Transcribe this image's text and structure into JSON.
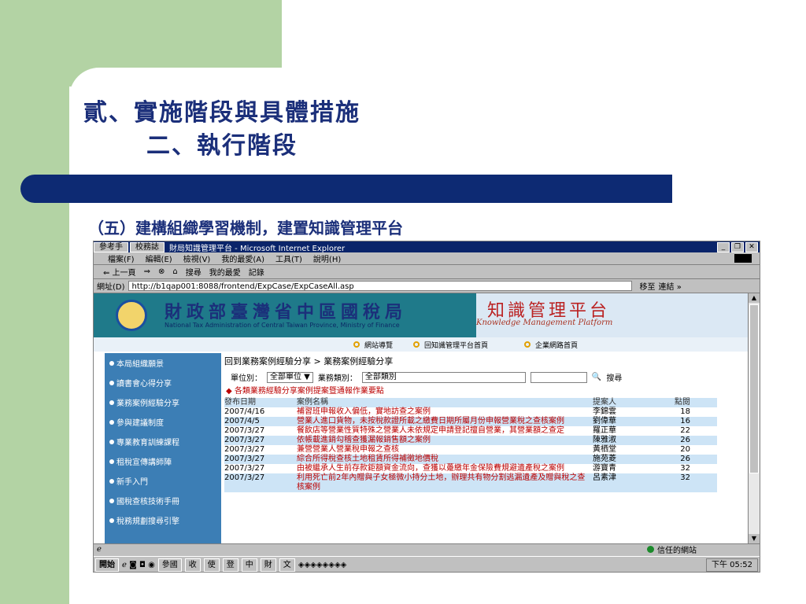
{
  "slide": {
    "title_line1": "貳、實施階段與具體措施",
    "title_line2": "二、執行階段",
    "subtitle": "（五）建構組織學習機制，建置知識管理平台"
  },
  "browser": {
    "title_tabs": [
      "參考手",
      "校務誌"
    ],
    "window_title": "財局知識管理平台 - Microsoft Internet Explorer",
    "menu": [
      "檔案(F)",
      "編輯(E)",
      "檢視(V)",
      "我的最愛(A)",
      "工具(T)",
      "說明(H)"
    ],
    "toolbar": [
      "⇐ 上一頁",
      "⇒",
      "⊗",
      "⌂",
      "搜尋",
      "我的最愛",
      "記錄"
    ],
    "address_label": "網址(D)",
    "address_value": "http://b1qap001:8088/frontend/ExpCase/ExpCaseAll.asp",
    "go_label": "移至",
    "links_label": "連結 »",
    "status_zone": "信任的網站"
  },
  "site": {
    "agency_name": "財政部臺灣省中區國稅局",
    "agency_en": "National Tax Administration of Central Taiwan Province, Ministry of Finance",
    "platform_title": "知識管理平台",
    "platform_en": "Knowledge Management Platform",
    "top_links": [
      "網站導覽",
      "回知識管理平台首頁",
      "企業網路首頁"
    ],
    "sidenav": [
      "本局組織願景",
      "讀書會心得分享",
      "業務案例經驗分享",
      "參與建議制度",
      "專業教育訓練課程",
      "租稅宣傳講師陣",
      "新手入門",
      "國稅查核技術手冊",
      "稅務規劃搜尋引擎"
    ],
    "breadcrumb": "回到業務案例經驗分享 > 業務案例經驗分享",
    "filter_unit_label": "單位別：",
    "filter_unit_value": "全部單位",
    "filter_type_label": "業務類別：",
    "filter_type_value": "全部類別",
    "search_label": "搜尋",
    "hint": "◆ 各類業務經驗分享案例提案暨通報作業要點",
    "table_headers": [
      "發布日期",
      "案例名稱",
      "提案人",
      "點閱"
    ],
    "rows": [
      {
        "date": "2007/4/16",
        "title": "補習班申報收入偏低，實地訪查之案例",
        "proposer": "李錦雲",
        "hits": "18"
      },
      {
        "date": "2007/4/5",
        "title": "營業人進口貨物，未按稅款證所載之繳費日期所屬月份申報營業稅之查核案例",
        "proposer": "劉偉華",
        "hits": "16"
      },
      {
        "date": "2007/3/27",
        "title": "餐飲店等營業性質特殊之營業人未依規定申請登記擅自營業，其營業額之查定",
        "proposer": "羅正華",
        "hits": "22"
      },
      {
        "date": "2007/3/27",
        "title": "依帳載進銷勾稽查獲漏報銷售額之案例",
        "proposer": "陳雅淑",
        "hits": "26"
      },
      {
        "date": "2007/3/27",
        "title": "兼營營業人營業稅申報之查核",
        "proposer": "黃栖堂",
        "hits": "20"
      },
      {
        "date": "2007/3/27",
        "title": "綜合所得稅查核土地租賃所得補徵地價稅",
        "proposer": "施苑菱",
        "hits": "26"
      },
      {
        "date": "2007/3/27",
        "title": "由被繼承人生前存款鉅額資金流向，查獲以躉繳年金保險費規避遺產稅之案例",
        "proposer": "游寶青",
        "hits": "32"
      },
      {
        "date": "2007/3/27",
        "title": "利用死亡前2年內贈與子女極微小持分土地，辦理共有物分割逃漏遺產及贈與稅之查核案例",
        "proposer": "呂素津",
        "hits": "32"
      }
    ]
  },
  "taskbar": {
    "start": "開始",
    "tasks": [
      "參國",
      "收",
      "使",
      "登",
      "中",
      "財",
      "文"
    ],
    "clock": "下午 05:52"
  }
}
